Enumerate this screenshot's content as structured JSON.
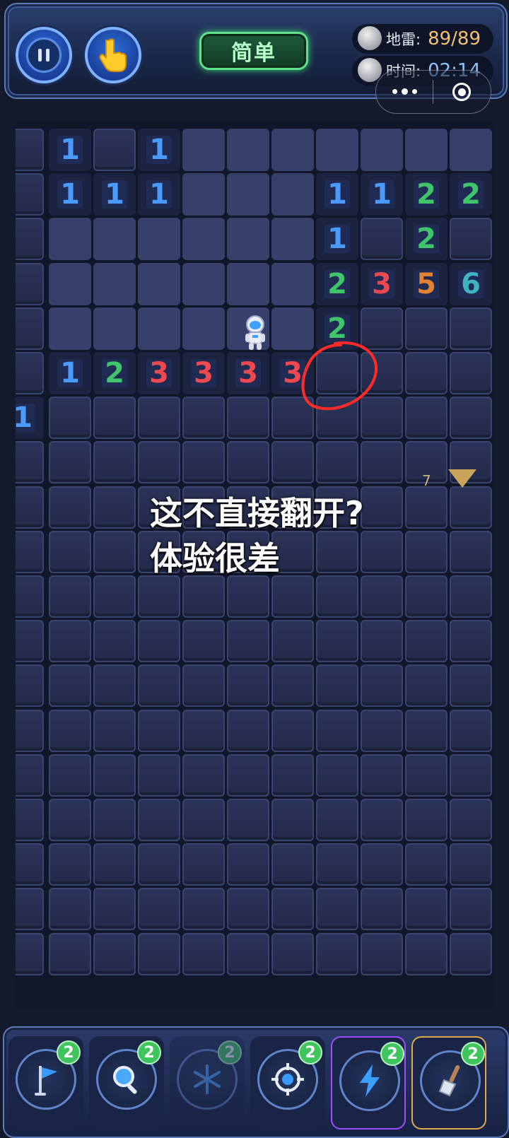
{
  "header": {
    "difficulty_label": "简单",
    "mines_label": "地雷:",
    "mines_value": "89/89",
    "time_label": "时间:",
    "time_value": "02:14"
  },
  "board": {
    "cells": [
      {
        "r": 0,
        "c": 1,
        "t": "1",
        "n": 1
      },
      {
        "r": 0,
        "c": 3,
        "t": "1",
        "n": 1
      },
      {
        "r": 1,
        "c": 1,
        "t": "1",
        "n": 1
      },
      {
        "r": 1,
        "c": 2,
        "t": "1",
        "n": 1
      },
      {
        "r": 1,
        "c": 3,
        "t": "1",
        "n": 1
      },
      {
        "r": 1,
        "c": 7,
        "t": "1",
        "n": 1
      },
      {
        "r": 1,
        "c": 8,
        "t": "1",
        "n": 1
      },
      {
        "r": 1,
        "c": 9,
        "t": "2",
        "n": 2
      },
      {
        "r": 1,
        "c": 10,
        "t": "2",
        "n": 2
      },
      {
        "r": 2,
        "c": 7,
        "t": "1",
        "n": 1
      },
      {
        "r": 2,
        "c": 9,
        "t": "2",
        "n": 2
      },
      {
        "r": 3,
        "c": 7,
        "t": "2",
        "n": 2
      },
      {
        "r": 3,
        "c": 8,
        "t": "3",
        "n": 3
      },
      {
        "r": 3,
        "c": 9,
        "t": "5",
        "n": 5
      },
      {
        "r": 3,
        "c": 10,
        "t": "6",
        "n": 6
      },
      {
        "r": 4,
        "c": 7,
        "t": "2",
        "n": 2
      },
      {
        "r": 5,
        "c": 1,
        "t": "1",
        "n": 1
      },
      {
        "r": 5,
        "c": 2,
        "t": "2",
        "n": 2
      },
      {
        "r": 5,
        "c": 3,
        "t": "3",
        "n": 3
      },
      {
        "r": 5,
        "c": 4,
        "t": "3",
        "n": 3
      },
      {
        "r": 5,
        "c": 5,
        "t": "3",
        "n": 3
      },
      {
        "r": 5,
        "c": 6,
        "t": "3",
        "n": 3
      },
      {
        "r": 6,
        "c": 0,
        "t": "1",
        "n": 1
      }
    ],
    "edge_number": "7"
  },
  "annotation": {
    "line1": "这不直接翻开?",
    "line2": "体验很差"
  },
  "tools": [
    {
      "name": "flag",
      "count": "2",
      "icon": "flag-icon"
    },
    {
      "name": "magnifier",
      "count": "2",
      "icon": "magnifier-icon"
    },
    {
      "name": "freeze",
      "count": "2",
      "icon": "snowflake-icon"
    },
    {
      "name": "target",
      "count": "2",
      "icon": "crosshair-icon"
    },
    {
      "name": "lightning",
      "count": "2",
      "icon": "lightning-icon"
    },
    {
      "name": "shovel",
      "count": "2",
      "icon": "shovel-icon"
    }
  ],
  "colors": {
    "n1": "#4b9bff",
    "n2": "#3fc46b",
    "n3": "#ee4850",
    "n5": "#e0822f",
    "n6": "#3fb3c2",
    "accent_green": "#5fe08a"
  }
}
